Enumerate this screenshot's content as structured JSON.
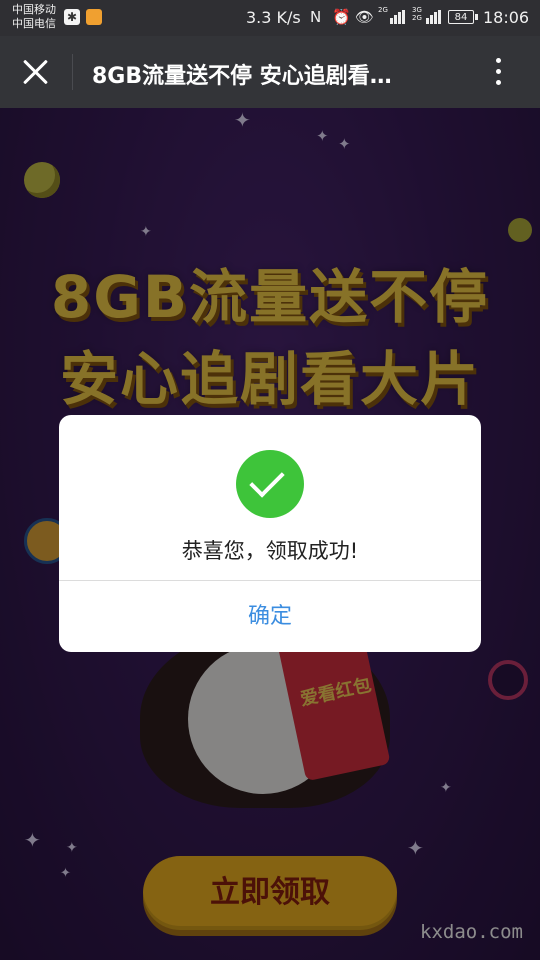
{
  "status_bar": {
    "carrier_1": "中国移动",
    "carrier_2": "中国电信",
    "speed": "3.3 K/s",
    "nfc": "N",
    "alarm_icon": "alarm-icon",
    "eye_icon": "eye-icon",
    "network_1": "2G",
    "network_2": "3G",
    "network_3": "2G",
    "battery": "84",
    "time": "18:06"
  },
  "title_bar": {
    "title": "8GB流量送不停 安心追剧看…",
    "close_icon": "close-icon",
    "more_icon": "more-vertical-icon"
  },
  "page": {
    "headline_line1": "8GB流量送不停",
    "headline_line2": "安心追剧看大片",
    "red_packet_text": "爱看红包",
    "claim_button": "立即领取",
    "watermark": "kxdao.com"
  },
  "dialog": {
    "success_icon": "check-circle-icon",
    "message": "恭喜您，领取成功!",
    "confirm_label": "确定"
  },
  "colors": {
    "dialog_confirm": "#3b8de0",
    "success": "#3ec43a",
    "headline": "#f6cf4a",
    "claim_button": "#f2b421"
  }
}
